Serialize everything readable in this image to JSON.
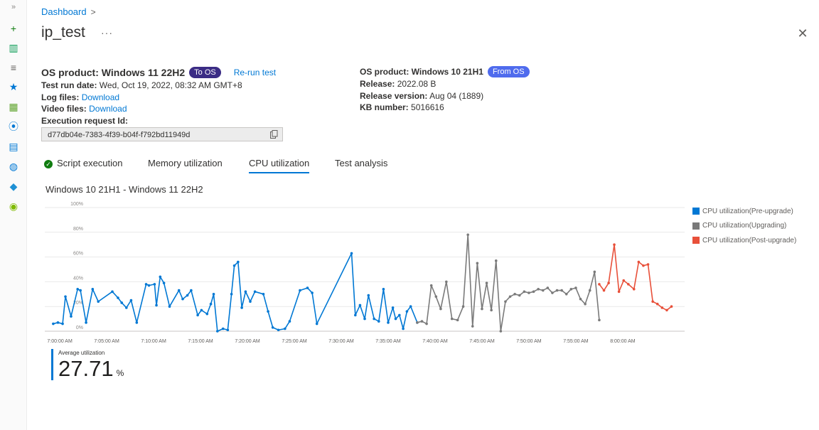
{
  "rail": {
    "expand": "»",
    "icons": [
      {
        "name": "create-icon",
        "glyph": "+",
        "color": "#107c10"
      },
      {
        "name": "dashboard-icon",
        "glyph": "▥",
        "color": "#0f9d58"
      },
      {
        "name": "all-services-icon",
        "glyph": "≡",
        "color": "#605e5c"
      },
      {
        "name": "favorites-icon",
        "glyph": "★",
        "color": "#0078d4"
      },
      {
        "name": "all-resources-icon",
        "glyph": "▦",
        "color": "#5ea32c"
      },
      {
        "name": "resource-groups-icon",
        "glyph": "⦿",
        "color": "#0078d4"
      },
      {
        "name": "sql-icon",
        "glyph": "▤",
        "color": "#0078d4"
      },
      {
        "name": "globe-icon",
        "glyph": "◍",
        "color": "#0078d4"
      },
      {
        "name": "diamond-icon",
        "glyph": "◆",
        "color": "#1e90d4"
      },
      {
        "name": "monitor-icon",
        "glyph": "◉",
        "color": "#7fba00"
      }
    ]
  },
  "breadcrumb": {
    "item": "Dashboard",
    "chevron": ">"
  },
  "page": {
    "title": "ip_test",
    "more": "···",
    "close": "✕"
  },
  "left": {
    "os_product_label": "OS product:",
    "os_product": "Windows 11 22H2",
    "badge": "To OS",
    "rerun": "Re-run test",
    "run_date_label": "Test run date:",
    "run_date": "Wed, Oct 19, 2022, 08:32 AM GMT+8",
    "log_label": "Log files:",
    "log_link": "Download",
    "video_label": "Video files:",
    "video_link": "Download",
    "exec_label": "Execution request Id:",
    "exec_id": "d77db04e-7383-4f39-b04f-f792bd11949d"
  },
  "right": {
    "os_product_label": "OS product:",
    "os_product": "Windows 10 21H1",
    "badge": "From OS",
    "release_label": "Release:",
    "release": "2022.08 B",
    "release_version_label": "Release version:",
    "release_version": "Aug 04 (1889)",
    "kb_label": "KB number:",
    "kb": "5016616"
  },
  "tabs": [
    "Script execution",
    "Memory utilization",
    "CPU utilization",
    "Test analysis"
  ],
  "active_tab": "CPU utilization",
  "colors": {
    "pre": "#0078d4",
    "upgrading": "#7a7a7a",
    "post": "#e8503a",
    "accent": "#0078d4"
  },
  "average": {
    "label": "Average utilization",
    "value": "27.71",
    "unit": "%"
  },
  "chart_data": {
    "type": "line",
    "title": "Windows 10 21H1 - Windows 11 22H2",
    "xlabel": "",
    "ylabel": "",
    "y_unit": "%",
    "ylim": [
      0,
      100
    ],
    "y_ticks": [
      "0%",
      "20%",
      "40%",
      "60%",
      "80%",
      "100%"
    ],
    "x_unit": "minutes after 7:00:00 AM",
    "x_ticks": [
      "7:00:00 AM",
      "7:05:00 AM",
      "7:10:00 AM",
      "7:15:00 AM",
      "7:20:00 AM",
      "7:25:00 AM",
      "7:30:00 AM",
      "7:35:00 AM",
      "7:40:00 AM",
      "7:45:00 AM",
      "7:50:00 AM",
      "7:55:00 AM",
      "8:00:00 AM"
    ],
    "xlim": [
      -1.6,
      66.6
    ],
    "grid": true,
    "legend_position": "right",
    "series": [
      {
        "name": "CPU utilization(Pre-upgrade)",
        "color": "#0078d4",
        "x": [
          -0.7,
          -0.2,
          0.3,
          0.6,
          1.2,
          1.9,
          2.2,
          2.8,
          3.5,
          4.1,
          5.6,
          6.2,
          6.6,
          7.1,
          7.6,
          8.2,
          9.2,
          9.5,
          10.1,
          10.3,
          10.7,
          11.1,
          11.7,
          12.7,
          13.1,
          13.6,
          14.0,
          14.7,
          15.1,
          15.7,
          16.1,
          16.4,
          16.8,
          17.4,
          17.9,
          18.3,
          18.6,
          19.0,
          19.4,
          19.8,
          20.3,
          20.8,
          21.7,
          22.2,
          22.7,
          23.3,
          24.0,
          24.5,
          25.6,
          26.4,
          26.9,
          27.4,
          31.1,
          31.5,
          32.0,
          32.5,
          32.9,
          33.5,
          34.0,
          34.5,
          35.0,
          35.5,
          35.8,
          36.2,
          36.6,
          37.0,
          37.4,
          38.1
        ],
        "y": [
          6,
          7,
          6,
          28,
          12,
          34,
          33,
          7,
          34,
          24,
          32,
          27,
          23,
          19,
          25,
          7,
          38,
          37,
          38,
          21,
          44,
          39,
          20,
          33,
          26,
          29,
          33,
          13,
          17,
          14,
          22,
          30,
          0,
          2,
          1,
          30,
          53,
          56,
          19,
          32,
          24,
          32,
          30,
          16,
          3,
          1,
          2,
          8,
          33,
          35,
          31,
          6,
          63,
          13,
          21,
          10,
          29,
          10,
          8,
          34,
          7,
          19,
          10,
          13,
          2,
          16,
          20,
          7
        ],
        "x_extra": [],
        "y_extra": []
      },
      {
        "name": "CPU utilization(Upgrading)",
        "color": "#7a7a7a",
        "x": [
          38.1,
          38.6,
          39.1,
          39.6,
          40.1,
          40.6,
          41.2,
          41.8,
          42.4,
          43.0,
          43.5,
          44.0,
          44.5,
          45.0,
          45.5,
          46.0,
          46.5,
          47.0,
          47.5,
          48.0,
          48.5,
          49.0,
          49.5,
          50.0,
          50.5,
          51.0,
          51.5,
          52.0,
          52.5,
          53.0,
          53.5,
          54.0,
          54.5,
          55.0,
          55.5,
          56.0,
          56.5,
          57.0,
          57.5
        ],
        "y": [
          7,
          8,
          6,
          37,
          28,
          18,
          40,
          10,
          9,
          20,
          78,
          4,
          55,
          18,
          39,
          17,
          57,
          0,
          24,
          28,
          30,
          29,
          32,
          31,
          32,
          34,
          33,
          35,
          31,
          33,
          33,
          30,
          34,
          35,
          26,
          22,
          33,
          48,
          9
        ],
        "x_extra": [],
        "y_extra": []
      },
      {
        "name": "CPU utilization(Post-upgrade)",
        "color": "#e8503a",
        "x": [
          57.5,
          58.0,
          58.5,
          59.1,
          59.6,
          60.1,
          60.6,
          61.2,
          61.7,
          62.2,
          62.7,
          63.2,
          63.7,
          64.2,
          64.7,
          65.2
        ],
        "y": [
          38,
          33,
          39,
          70,
          32,
          41,
          38,
          34,
          56,
          53,
          54,
          24,
          22,
          19,
          17,
          20
        ],
        "x_extra": [],
        "y_extra": []
      }
    ]
  }
}
